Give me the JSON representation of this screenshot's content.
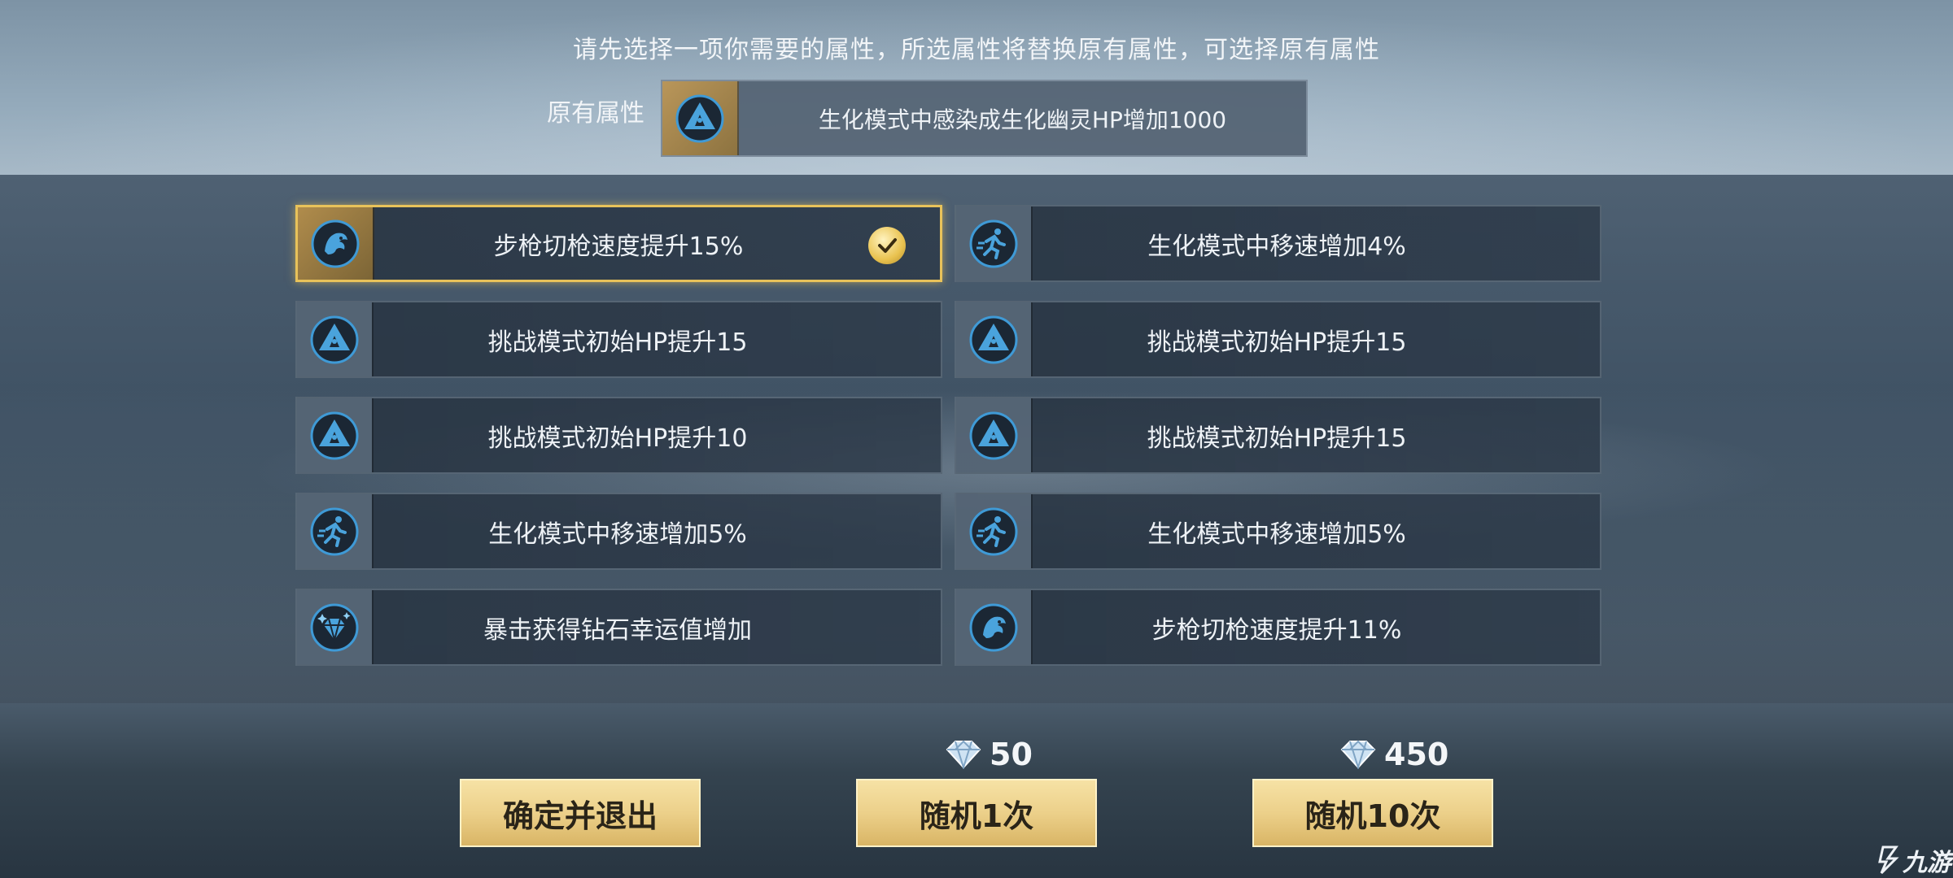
{
  "instruction": "请先选择一项你需要的属性，所选属性将替换原有属性，可选择原有属性",
  "original": {
    "label": "原有属性",
    "icon": "biohazard-hp-icon",
    "text": "生化模式中感染成生化幽灵HP增加1000"
  },
  "attributes": [
    {
      "text": "步枪切枪速度提升15%",
      "icon": "dragon-icon",
      "selected": true
    },
    {
      "text": "生化模式中移速增加4%",
      "icon": "runner-icon",
      "selected": false
    },
    {
      "text": "挑战模式初始HP提升15",
      "icon": "hp-up-icon",
      "selected": false
    },
    {
      "text": "挑战模式初始HP提升15",
      "icon": "hp-up-icon",
      "selected": false
    },
    {
      "text": "挑战模式初始HP提升10",
      "icon": "hp-up-icon",
      "selected": false
    },
    {
      "text": "挑战模式初始HP提升15",
      "icon": "hp-up-icon",
      "selected": false
    },
    {
      "text": "生化模式中移速增加5%",
      "icon": "runner-icon",
      "selected": false
    },
    {
      "text": "生化模式中移速增加5%",
      "icon": "runner-icon",
      "selected": false
    },
    {
      "text": "暴击获得钻石幸运值增加",
      "icon": "diamond-luck-icon",
      "selected": false
    },
    {
      "text": "步枪切枪速度提升11%",
      "icon": "dragon-icon",
      "selected": false
    }
  ],
  "costs": {
    "random1": "50",
    "random10": "450",
    "currency_icon": "diamond-icon"
  },
  "buttons": {
    "confirm": "确定并退出",
    "random1": "随机1次",
    "random10": "随机10次"
  },
  "watermark": "九游",
  "colors": {
    "accent_gold": "#e8c25a",
    "icon_blue": "#3f9ad6",
    "button_gold": "#ecd08a"
  }
}
